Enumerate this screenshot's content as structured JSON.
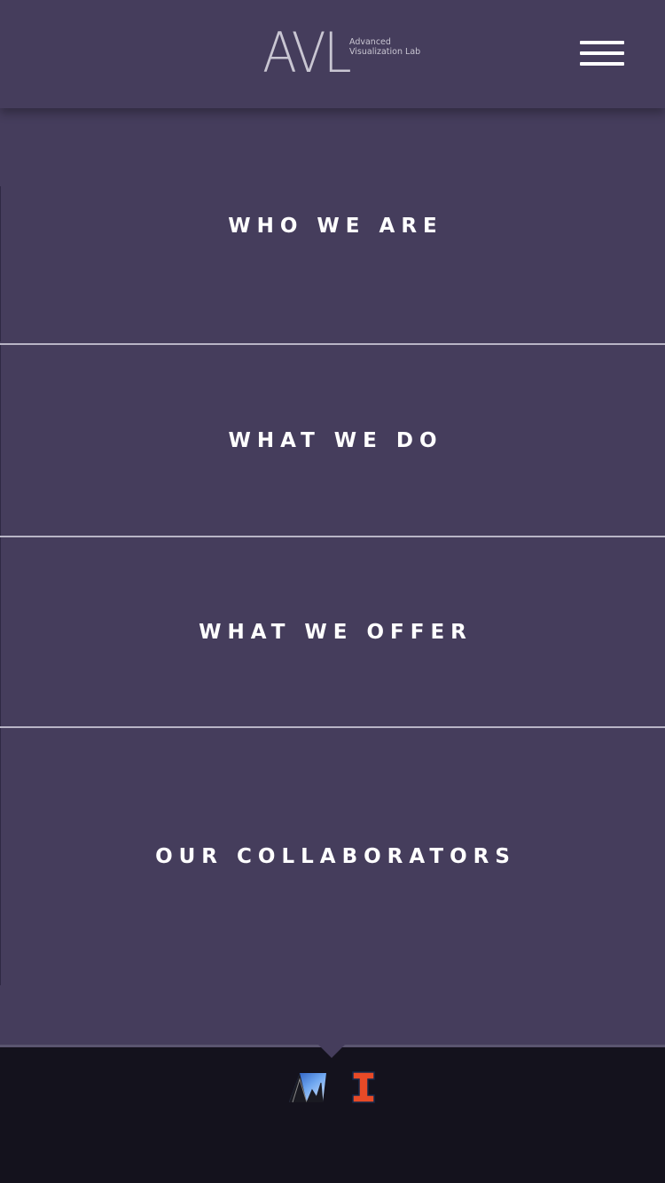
{
  "header": {
    "logo_text": "AVL",
    "logo_subtitle_line1": "Advanced",
    "logo_subtitle_line2": "Visualization Lab",
    "menu_icon": "hamburger-menu-icon"
  },
  "nav": {
    "items": [
      {
        "label": "WHO WE ARE"
      },
      {
        "label": "WHAT WE DO"
      },
      {
        "label": "WHAT WE OFFER"
      },
      {
        "label": "OUR COLLABORATORS"
      }
    ]
  },
  "footer": {
    "logos": [
      "ncsa-logo",
      "illinois-block-i-logo"
    ]
  },
  "colors": {
    "background": "#453d5c",
    "footer": "#14121d",
    "divider": "#b9b5c6",
    "text": "#ffffff",
    "illinois_orange": "#e84a27"
  }
}
